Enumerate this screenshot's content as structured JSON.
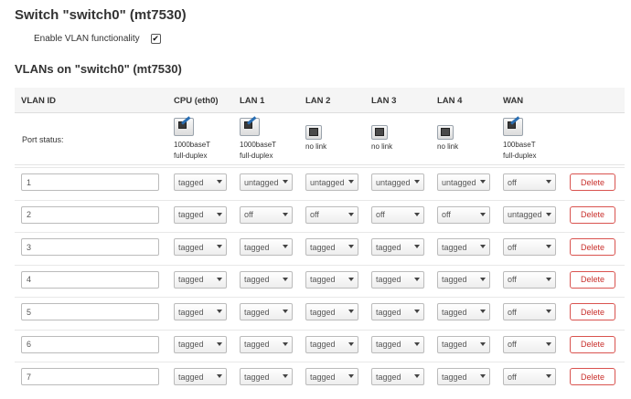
{
  "switch_title": "Switch \"switch0\" (mt7530)",
  "enable_vlan": {
    "label": "Enable VLAN functionality",
    "checked": true,
    "check_glyph": "✔"
  },
  "vlans_title": "VLANs on \"switch0\" (mt7530)",
  "columns": [
    "VLAN ID",
    "CPU (eth0)",
    "LAN 1",
    "LAN 2",
    "LAN 3",
    "LAN 4",
    "WAN"
  ],
  "port_status": {
    "label": "Port status:",
    "ports": [
      {
        "icon": "port-connected-icon",
        "line1": "1000baseT",
        "line2": "full-duplex",
        "linked": true
      },
      {
        "icon": "port-connected-icon",
        "line1": "1000baseT",
        "line2": "full-duplex",
        "linked": true
      },
      {
        "icon": "port-disconnected-icon",
        "line1": "no link",
        "line2": "",
        "linked": false
      },
      {
        "icon": "port-disconnected-icon",
        "line1": "no link",
        "line2": "",
        "linked": false
      },
      {
        "icon": "port-disconnected-icon",
        "line1": "no link",
        "line2": "",
        "linked": false
      },
      {
        "icon": "port-connected-icon",
        "line1": "100baseT",
        "line2": "full-duplex",
        "linked": true
      }
    ]
  },
  "delete_label": "Delete",
  "vlans": [
    {
      "id": "1",
      "ports": [
        "tagged",
        "untagged",
        "untagged",
        "untagged",
        "untagged",
        "off"
      ]
    },
    {
      "id": "2",
      "ports": [
        "tagged",
        "off",
        "off",
        "off",
        "off",
        "untagged"
      ]
    },
    {
      "id": "3",
      "ports": [
        "tagged",
        "tagged",
        "tagged",
        "tagged",
        "tagged",
        "off"
      ]
    },
    {
      "id": "4",
      "ports": [
        "tagged",
        "tagged",
        "tagged",
        "tagged",
        "tagged",
        "off"
      ]
    },
    {
      "id": "5",
      "ports": [
        "tagged",
        "tagged",
        "tagged",
        "tagged",
        "tagged",
        "off"
      ]
    },
    {
      "id": "6",
      "ports": [
        "tagged",
        "tagged",
        "tagged",
        "tagged",
        "tagged",
        "off"
      ]
    },
    {
      "id": "7",
      "ports": [
        "tagged",
        "tagged",
        "tagged",
        "tagged",
        "tagged",
        "off"
      ]
    }
  ]
}
